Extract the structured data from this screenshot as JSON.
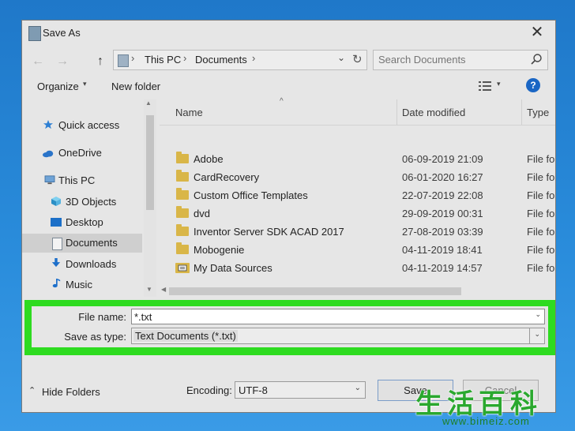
{
  "dialog": {
    "title": "Save As",
    "close_glyph": "✕"
  },
  "nav": {
    "back_glyph": "←",
    "forward_glyph": "→",
    "up_glyph": "↑",
    "breadcrumb": [
      "This PC",
      "Documents"
    ],
    "separator_glyph": "›",
    "dropdown_glyph": "⌄",
    "refresh_glyph": "↻"
  },
  "search": {
    "placeholder": "Search Documents"
  },
  "toolbar": {
    "organize_label": "Organize",
    "new_folder_label": "New folder",
    "help_glyph": "?",
    "caret_glyph": "▾"
  },
  "sidebar": {
    "items": [
      {
        "label": "Quick access",
        "icon": "star-icon"
      },
      {
        "label": "OneDrive",
        "icon": "cloud-icon"
      },
      {
        "label": "This PC",
        "icon": "computer-icon"
      },
      {
        "label": "3D Objects",
        "icon": "cube-icon"
      },
      {
        "label": "Desktop",
        "icon": "desktop-icon"
      },
      {
        "label": "Documents",
        "icon": "document-icon",
        "selected": true
      },
      {
        "label": "Downloads",
        "icon": "download-icon"
      },
      {
        "label": "Music",
        "icon": "music-icon"
      }
    ]
  },
  "filelist": {
    "columns": {
      "name": "Name",
      "date": "Date modified",
      "type": "Type"
    },
    "sort_glyph": "^",
    "rows": [
      {
        "name": "Adobe",
        "date": "06-09-2019 21:09",
        "type": "File fo",
        "icon": "folder-icon"
      },
      {
        "name": "CardRecovery",
        "date": "06-01-2020 16:27",
        "type": "File fo",
        "icon": "folder-icon"
      },
      {
        "name": "Custom Office Templates",
        "date": "22-07-2019 22:08",
        "type": "File fo",
        "icon": "folder-icon"
      },
      {
        "name": "dvd",
        "date": "29-09-2019 00:31",
        "type": "File fo",
        "icon": "folder-icon"
      },
      {
        "name": "Inventor Server SDK ACAD 2017",
        "date": "27-08-2019 03:39",
        "type": "File fo",
        "icon": "folder-icon"
      },
      {
        "name": "Mobogenie",
        "date": "04-11-2019 18:41",
        "type": "File fo",
        "icon": "folder-icon"
      },
      {
        "name": "My Data Sources",
        "date": "04-11-2019 14:57",
        "type": "File fo",
        "icon": "data-sources-icon"
      }
    ]
  },
  "form": {
    "file_name_label": "File name:",
    "file_name_value": "*.txt",
    "save_type_label": "Save as type:",
    "save_type_value": "Text Documents (*.txt)",
    "highlight_color": "#2edb20"
  },
  "footer": {
    "hide_folders_label": "Hide Folders",
    "hide_glyph": "⌃",
    "encoding_label": "Encoding:",
    "encoding_value": "UTF-8",
    "save_label": "Save",
    "cancel_label": "Cancel"
  },
  "watermark": {
    "chars": "生活百科",
    "url": "www.bimeiz.com"
  }
}
